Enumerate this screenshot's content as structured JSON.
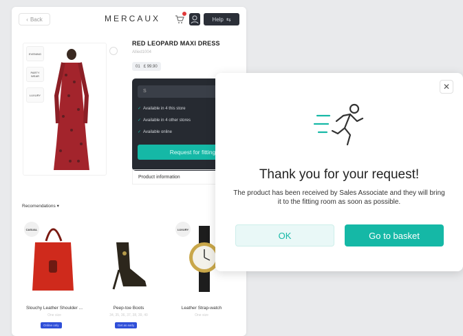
{
  "header": {
    "back_label": "Back",
    "logo": "MERCAUX",
    "help_label": "Help"
  },
  "product": {
    "thumbs": [
      "EVENING",
      "PARTY WEAR",
      "LUXURY"
    ],
    "title": "RED LEOPARD MAXI DRESS",
    "code": "Allied1004",
    "size_badge": "01",
    "price": "£ 99.90",
    "size_select": "S",
    "availability": [
      "Available in 4 this store",
      "Available in 4 other stores",
      "Available online"
    ],
    "fitting_button": "Request for fitting",
    "info_label": "Product information"
  },
  "recommendations": {
    "label": "Recomendations",
    "items": [
      {
        "tag": "CASUAL",
        "name": "Slouchy Leather Shoulder ...",
        "sizes": "One size",
        "badge": "Online only"
      },
      {
        "tag": "",
        "name": "Peep-toe Boots",
        "sizes": "34, 35, 36, 37, 38, 39, 40",
        "badge": "Get as early"
      },
      {
        "tag": "LUXURY",
        "name": "Leather Strap-watch",
        "sizes": "One size",
        "badge": ""
      }
    ]
  },
  "modal": {
    "title": "Thank you for your request!",
    "message": "The product has been received by Sales Associate and they will bring it to the fitting room as soon as possible.",
    "ok_label": "OK",
    "basket_label": "Go to basket"
  },
  "colors": {
    "accent": "#15b8a6",
    "dark": "#262a31",
    "badge": "#2f4fd8",
    "dress": "#a3242c"
  },
  "icons": {
    "cart": "cart-icon",
    "account": "account-icon",
    "help": "help-icon",
    "close": "close-icon",
    "runner": "runner-icon",
    "check": "check-icon"
  }
}
